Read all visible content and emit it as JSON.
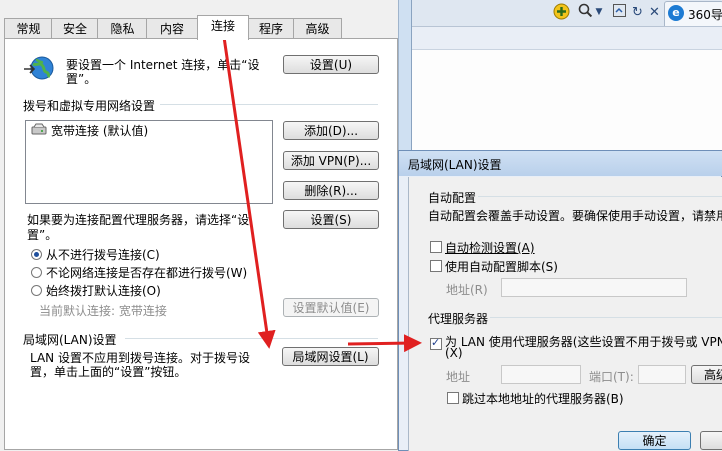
{
  "browser": {
    "toolbar_icons": [
      "add-icon",
      "search-icon",
      "dropdown-icon",
      "zoom-icon",
      "refresh-icon",
      "close-icon"
    ],
    "tab_label": "360导"
  },
  "internet_options": {
    "tabs": [
      "常规",
      "安全",
      "隐私",
      "内容",
      "连接",
      "程序",
      "高级"
    ],
    "selected_tab": "连接",
    "setup_text": "要设置一个 Internet 连接，单击“设置”。",
    "setup_button": "设置(U)",
    "dialup_vpn_heading": "拨号和虚拟专用网络设置",
    "connections": [
      "宽带连接 (默认值)"
    ],
    "add_button": "添加(D)...",
    "add_vpn_button": "添加 VPN(P)...",
    "remove_button": "删除(R)...",
    "proxy_text_line1": "如果要为连接配置代理服务器，请选择“设",
    "proxy_text_line2": "置”。",
    "settings_button": "设置(S)",
    "radio_options": [
      {
        "label": "从不进行拨号连接(C)",
        "selected": true
      },
      {
        "label": "不论网络连接是否存在都进行拨号(W)",
        "selected": false
      },
      {
        "label": "始终拨打默认连接(O)",
        "selected": false
      }
    ],
    "current_default_label": "当前默认连接: 宽带连接",
    "set_default_button": "设置默认值(E)",
    "lan_heading": "局域网(LAN)设置",
    "lan_text_line1": "LAN 设置不应用到拨号连接。对于拨号设",
    "lan_text_line2": "置，单击上面的“设置”按钮。",
    "lan_settings_button": "局域网设置(L)"
  },
  "lan_settings": {
    "title": "局域网(LAN)设置",
    "auto_config_heading": "自动配置",
    "auto_config_desc": "自动配置会覆盖手动设置。要确保使用手动设置，请禁用",
    "auto_detect_label": "自动检测设置(A)",
    "auto_detect_checked": false,
    "auto_script_label": "使用自动配置脚本(S)",
    "auto_script_checked": false,
    "address_label": "地址(R)",
    "proxy_heading": "代理服务器",
    "use_proxy_label": "为 LAN 使用代理服务器(这些设置不用于拨号或 VPN",
    "use_proxy_label_cont": "(X)",
    "use_proxy_checked": true,
    "proxy_address_label": "地址",
    "port_label": "端口(T):",
    "advanced_button": "高级",
    "bypass_local_label": "跳过本地地址的代理服务器(B)",
    "bypass_local_checked": false,
    "ok_button": "确定"
  },
  "colors": {
    "annotation_arrow": "#e02020",
    "lan_titlebar": "#c4d8ef"
  }
}
